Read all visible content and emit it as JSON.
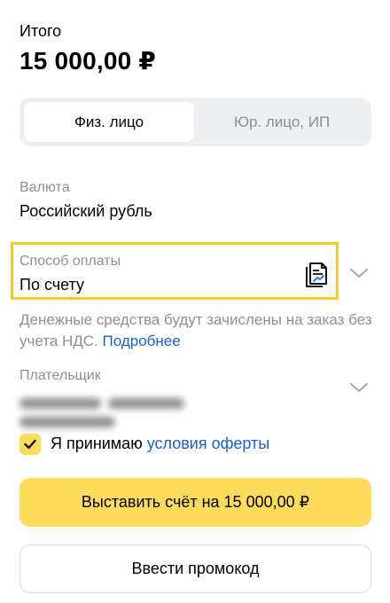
{
  "total": {
    "label": "Итого",
    "amount": "15 000,00 ₽"
  },
  "payer_type": {
    "options": [
      "Физ. лицо",
      "Юр. лицо, ИП"
    ],
    "selected": "Физ. лицо"
  },
  "currency": {
    "caption": "Валюта",
    "value": "Российский рубль"
  },
  "payment_method": {
    "caption": "Способ оплаты",
    "value": "По счету",
    "icon": "invoice-document-icon",
    "highlight_color": "#f4cc29"
  },
  "note": {
    "text": "Денежные средства будут зачислены на заказ без учета НДС. ",
    "link": "Подробнее"
  },
  "payer": {
    "caption": "Плательщик",
    "value_hidden": true
  },
  "terms": {
    "checked": true,
    "text": "Я принимаю ",
    "link": "условия оферты"
  },
  "buttons": {
    "issue_invoice": "Выставить счёт на 15 000,00 ₽",
    "promo_code": "Ввести промокод"
  },
  "colors": {
    "accent_yellow": "#fddc5c",
    "link_blue": "#1a5fd6",
    "muted_text": "#8b8f96"
  }
}
